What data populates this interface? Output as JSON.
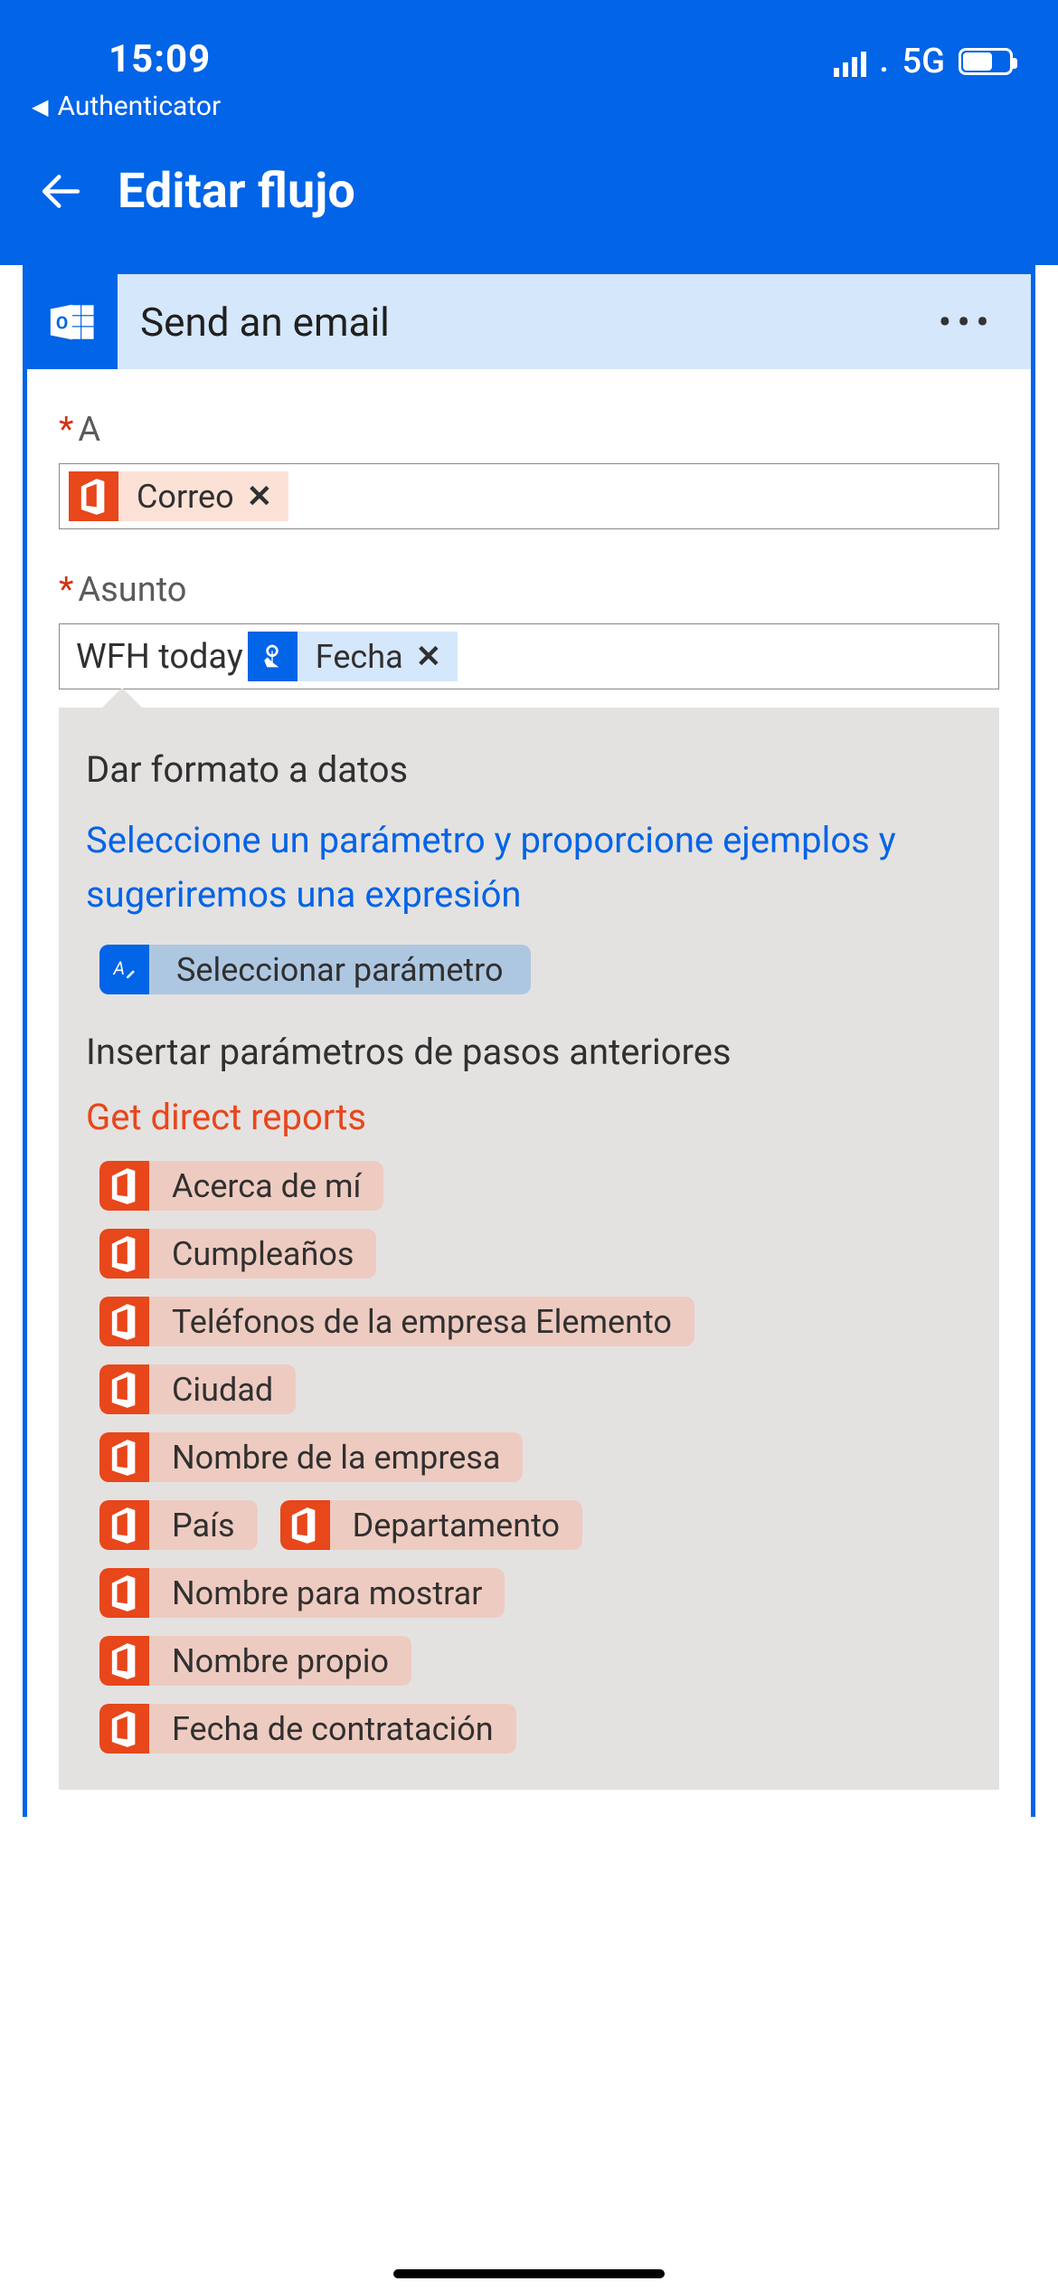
{
  "status": {
    "time": "15:09",
    "net_label": "5G",
    "return_app": "Authenticator"
  },
  "nav": {
    "title": "Editar flujo"
  },
  "card": {
    "title": "Send an email",
    "to_label": "A",
    "subject_label": "Asunto",
    "to_chip": "Correo",
    "subject_text": "WFH today",
    "subject_chip": "Fecha"
  },
  "panel": {
    "heading": "Dar formato a datos",
    "link_text": "Seleccione un parámetro y proporcione ejemplos y sugeriremos una expresión",
    "select_param": "Seleccionar parámetro",
    "insert_heading": "Insertar parámetros de pasos anteriores",
    "source": "Get direct reports",
    "tokens": [
      "Acerca de mí",
      "Cumpleaños",
      "Teléfonos de la empresa Elemento",
      "Ciudad",
      "Nombre de la empresa",
      "País",
      "Departamento",
      "Nombre para mostrar",
      "Nombre propio",
      "Fecha de contratación"
    ]
  }
}
